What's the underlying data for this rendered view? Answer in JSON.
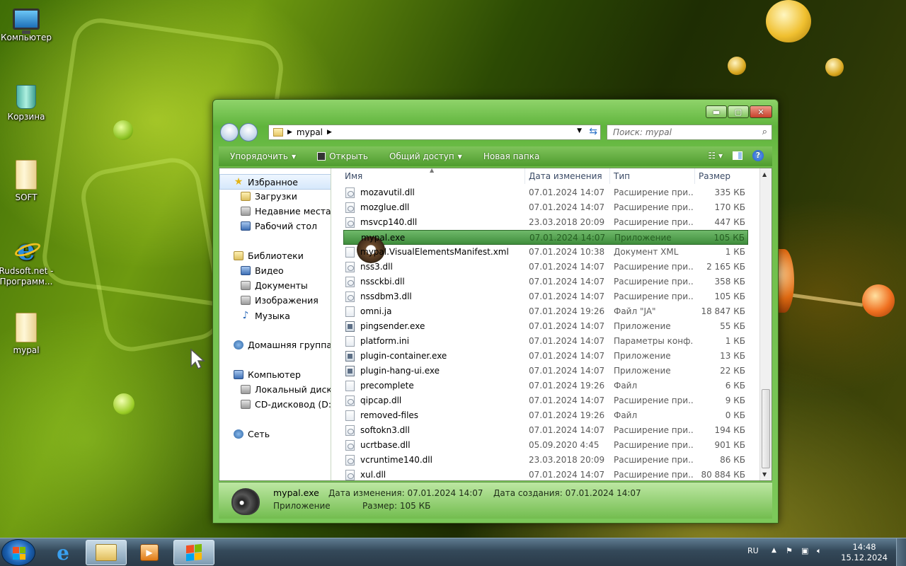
{
  "desktop": {
    "icons": [
      {
        "label": "Компьютер",
        "icon": "computer-icon"
      },
      {
        "label": "Корзина",
        "icon": "recycle-bin-icon"
      },
      {
        "label": "SOFT",
        "icon": "folder-icon"
      },
      {
        "label": "Rudsoft.net - Программ...",
        "icon": "internet-explorer-icon"
      },
      {
        "label": "mypal",
        "icon": "folder-icon"
      }
    ]
  },
  "window": {
    "breadcrumb": "mypal",
    "search_placeholder": "Поиск: mypal",
    "toolbar": {
      "organize": "Упорядочить",
      "open": "Открыть",
      "share": "Общий доступ",
      "new_folder": "Новая папка"
    },
    "nav": {
      "favorites": "Избранное",
      "downloads": "Загрузки",
      "recent": "Недавние места",
      "desktop": "Рабочий стол",
      "libraries": "Библиотеки",
      "video": "Видео",
      "documents": "Документы",
      "images": "Изображения",
      "music": "Музыка",
      "homegroup": "Домашняя группа",
      "computer": "Компьютер",
      "local_disk": "Локальный диск",
      "cd_drive": "CD-дисковод (D:)",
      "network": "Сеть"
    },
    "columns": {
      "name": "Имя",
      "date": "Дата изменения",
      "type": "Тип",
      "size": "Размер"
    },
    "files": [
      {
        "name": "mozavutil.dll",
        "date": "07.01.2024 14:07",
        "type": "Расширение при...",
        "size": "335 КБ",
        "icon": "dll-file-icon"
      },
      {
        "name": "mozglue.dll",
        "date": "07.01.2024 14:07",
        "type": "Расширение при...",
        "size": "170 КБ",
        "icon": "dll-file-icon"
      },
      {
        "name": "msvcp140.dll",
        "date": "23.03.2018 20:09",
        "type": "Расширение при...",
        "size": "447 КБ",
        "icon": "dll-file-icon"
      },
      {
        "name": "mypal.exe",
        "date": "07.01.2024 14:07",
        "type": "Приложение",
        "size": "105 КБ",
        "icon": "mypal-app-icon",
        "selected": true
      },
      {
        "name": "mypal.VisualElementsManifest.xml",
        "date": "07.01.2024 10:38",
        "type": "Документ XML",
        "size": "1 КБ",
        "icon": "xml-file-icon"
      },
      {
        "name": "nss3.dll",
        "date": "07.01.2024 14:07",
        "type": "Расширение при...",
        "size": "2 165 КБ",
        "icon": "dll-file-icon"
      },
      {
        "name": "nssckbi.dll",
        "date": "07.01.2024 14:07",
        "type": "Расширение при...",
        "size": "358 КБ",
        "icon": "dll-file-icon"
      },
      {
        "name": "nssdbm3.dll",
        "date": "07.01.2024 14:07",
        "type": "Расширение при...",
        "size": "105 КБ",
        "icon": "dll-file-icon"
      },
      {
        "name": "omni.ja",
        "date": "07.01.2024 19:26",
        "type": "Файл \"JA\"",
        "size": "18 847 КБ",
        "icon": "file-icon"
      },
      {
        "name": "pingsender.exe",
        "date": "07.01.2024 14:07",
        "type": "Приложение",
        "size": "55 КБ",
        "icon": "exe-file-icon"
      },
      {
        "name": "platform.ini",
        "date": "07.01.2024 14:07",
        "type": "Параметры конф...",
        "size": "1 КБ",
        "icon": "ini-file-icon"
      },
      {
        "name": "plugin-container.exe",
        "date": "07.01.2024 14:07",
        "type": "Приложение",
        "size": "13 КБ",
        "icon": "exe-file-icon"
      },
      {
        "name": "plugin-hang-ui.exe",
        "date": "07.01.2024 14:07",
        "type": "Приложение",
        "size": "22 КБ",
        "icon": "exe-file-icon"
      },
      {
        "name": "precomplete",
        "date": "07.01.2024 19:26",
        "type": "Файл",
        "size": "6 КБ",
        "icon": "file-icon"
      },
      {
        "name": "qipcap.dll",
        "date": "07.01.2024 14:07",
        "type": "Расширение при...",
        "size": "9 КБ",
        "icon": "dll-file-icon"
      },
      {
        "name": "removed-files",
        "date": "07.01.2024 19:26",
        "type": "Файл",
        "size": "0 КБ",
        "icon": "file-icon"
      },
      {
        "name": "softokn3.dll",
        "date": "07.01.2024 14:07",
        "type": "Расширение при...",
        "size": "194 КБ",
        "icon": "dll-file-icon"
      },
      {
        "name": "ucrtbase.dll",
        "date": "05.09.2020 4:45",
        "type": "Расширение при...",
        "size": "901 КБ",
        "icon": "dll-file-icon"
      },
      {
        "name": "vcruntime140.dll",
        "date": "23.03.2018 20:09",
        "type": "Расширение при...",
        "size": "86 КБ",
        "icon": "dll-file-icon"
      },
      {
        "name": "xul.dll",
        "date": "07.01.2024 14:07",
        "type": "Расширение при...",
        "size": "80 884 КБ",
        "icon": "dll-file-icon"
      }
    ],
    "details": {
      "name": "mypal.exe",
      "type": "Приложение",
      "modified": "Дата изменения: 07.01.2024 14:07",
      "created": "Дата создания: 07.01.2024 14:07",
      "size": "Размер: 105 КБ"
    }
  },
  "taskbar": {
    "language": "RU",
    "time": "14:48",
    "date": "15.12.2024"
  }
}
